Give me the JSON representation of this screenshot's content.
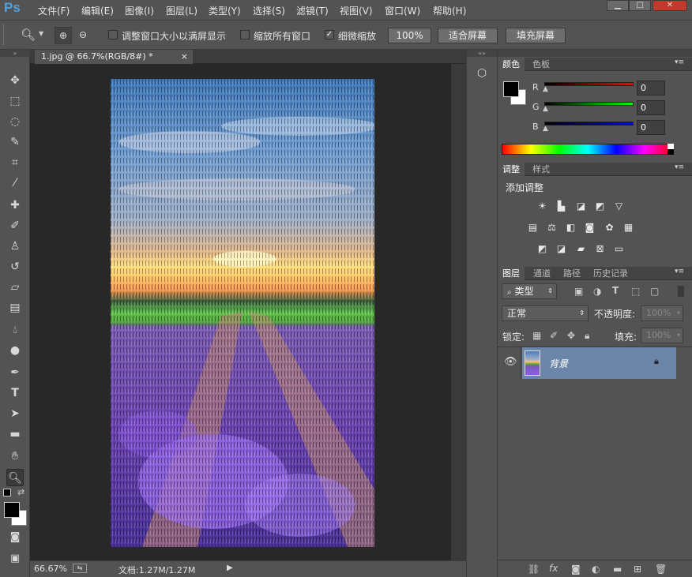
{
  "app": {
    "logo": "Ps"
  },
  "menu": [
    "文件(F)",
    "编辑(E)",
    "图像(I)",
    "图层(L)",
    "类型(Y)",
    "选择(S)",
    "滤镜(T)",
    "视图(V)",
    "窗口(W)",
    "帮助(H)"
  ],
  "window_buttons": {
    "minimize": "▁",
    "maximize": "□",
    "close": "✕"
  },
  "options": {
    "resize_windows_label": "调整窗口大小以满屏显示",
    "zoom_all_label": "缩放所有窗口",
    "scrubby_label": "细微缩放",
    "pct_btn": "100%",
    "fit_btn": "适合屏幕",
    "fill_btn": "填充屏幕"
  },
  "document": {
    "tab_title": "1.jpg @ 66.7%(RGB/8#) *",
    "tab_close": "×",
    "zoom": "66.67%",
    "doc_info": "文档:1.27M/1.27M"
  },
  "color_panel": {
    "tabs": [
      "颜色",
      "色板"
    ],
    "r_label": "R",
    "g_label": "G",
    "b_label": "B",
    "r": "0",
    "g": "0",
    "b": "0"
  },
  "adjust_panel": {
    "tabs": [
      "调整",
      "样式"
    ],
    "title": "添加调整"
  },
  "layers_panel": {
    "tabs": [
      "图层",
      "通道",
      "路径",
      "历史记录"
    ],
    "filter_kind": "类型",
    "blend_mode": "正常",
    "opacity_label": "不透明度:",
    "opacity_value": "100%",
    "lock_label": "锁定:",
    "fill_label": "填充:",
    "fill_value": "100%",
    "layer_name": "背景"
  },
  "colors": {
    "accent": "#4aa3e8",
    "panel_bg": "#535353",
    "selected_layer": "#6b86a8"
  }
}
